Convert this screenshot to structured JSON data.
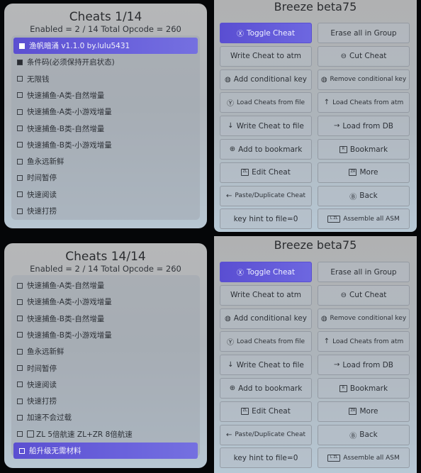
{
  "screens": [
    {
      "cheats": {
        "title": "Cheats 1/14",
        "subtitle": "Enabled = 2 / 14  Total Opcode = 260",
        "items": [
          {
            "label": "渔帆暗涌 v1.1.0 by.lulu5431",
            "checked": true,
            "selected": true
          },
          {
            "label": "条件码(必须保持开启状态)",
            "checked": true,
            "selected": false
          },
          {
            "label": "无限钱",
            "checked": false,
            "selected": false
          },
          {
            "label": "快速捕鱼-A类-自然增量",
            "checked": false,
            "selected": false
          },
          {
            "label": "快速捕鱼-A类-小游戏增量",
            "checked": false,
            "selected": false
          },
          {
            "label": "快速捕鱼-B类-自然增量",
            "checked": false,
            "selected": false
          },
          {
            "label": "快速捕鱼-B类-小游戏增量",
            "checked": false,
            "selected": false
          },
          {
            "label": "鱼永远新鲜",
            "checked": false,
            "selected": false
          },
          {
            "label": "时间暂停",
            "checked": false,
            "selected": false
          },
          {
            "label": "快速阅读",
            "checked": false,
            "selected": false
          },
          {
            "label": "快速打捞",
            "checked": false,
            "selected": false
          }
        ]
      },
      "menu": {
        "title": "Breeze beta75",
        "buttons": [
          {
            "icon": "Ⓧ",
            "icon_name": "x-button-icon",
            "label": "Toggle Cheat",
            "primary": true
          },
          {
            "icon": "",
            "icon_name": "",
            "label": "Erase all in Group"
          },
          {
            "icon": "",
            "icon_name": "",
            "label": "Write Cheat to atm"
          },
          {
            "icon": "⊖",
            "icon_name": "minus-button-icon",
            "label": "Cut Cheat"
          },
          {
            "icon": "◍",
            "icon_name": "left-stick-icon",
            "label": "Add conditional key"
          },
          {
            "icon": "◍",
            "icon_name": "right-stick-icon",
            "label": "Remove conditional key",
            "small": true
          },
          {
            "icon": "Ⓨ",
            "icon_name": "y-button-icon",
            "label": "Load Cheats from file",
            "small": true
          },
          {
            "icon": "↑",
            "icon_name": "dpad-up-icon",
            "label": "Load Cheats from atm",
            "small": true
          },
          {
            "icon": "↓",
            "icon_name": "dpad-down-icon",
            "label": "Write Cheat to file"
          },
          {
            "icon": "→",
            "icon_name": "dpad-right-icon",
            "label": "Load from DB"
          },
          {
            "icon": "⊕",
            "icon_name": "plus-button-icon",
            "label": "Add to bookmark"
          },
          {
            "icon": "R",
            "icon_name": "r-button-icon",
            "label": "Bookmark",
            "kbd": true
          },
          {
            "icon": "ZL",
            "icon_name": "zl-button-icon",
            "label": "Edit Cheat",
            "kbd": true
          },
          {
            "icon": "ZR",
            "icon_name": "zr-button-icon",
            "label": "More",
            "kbd": true
          },
          {
            "icon": "←",
            "icon_name": "dpad-left-icon",
            "label": "Paste/Duplicate Cheat",
            "small": true
          },
          {
            "icon": "Ⓑ",
            "icon_name": "b-button-icon",
            "label": "Back"
          },
          {
            "icon": "",
            "icon_name": "",
            "label": "key hint to file=0"
          },
          {
            "icon": "L ZL",
            "icon_name": "l-zl-button-icon",
            "label": "Assemble all ASM",
            "kbd": true,
            "small": true
          }
        ]
      }
    },
    {
      "cheats": {
        "title": "Cheats 14/14",
        "subtitle": "Enabled = 2 / 14  Total Opcode = 260",
        "items": [
          {
            "label": "快速捕鱼-A类-自然增量",
            "checked": false,
            "selected": false
          },
          {
            "label": "快速捕鱼-A类-小游戏增量",
            "checked": false,
            "selected": false
          },
          {
            "label": "快速捕鱼-B类-自然增量",
            "checked": false,
            "selected": false
          },
          {
            "label": "快速捕鱼-B类-小游戏增量",
            "checked": false,
            "selected": false
          },
          {
            "label": "鱼永远新鲜",
            "checked": false,
            "selected": false
          },
          {
            "label": "时间暂停",
            "checked": false,
            "selected": false
          },
          {
            "label": "快速阅读",
            "checked": false,
            "selected": false
          },
          {
            "label": "快速打捞",
            "checked": false,
            "selected": false
          },
          {
            "label": "加速不会过载",
            "checked": false,
            "selected": false
          },
          {
            "label": "ZL 5倍航速  ZL+ZR 8倍航速",
            "checked": false,
            "selected": false,
            "kbd": "ZL"
          },
          {
            "label": "船升级无需材料",
            "checked": false,
            "selected": true
          }
        ]
      },
      "menu": {
        "title": "Breeze beta75",
        "buttons": [
          {
            "icon": "Ⓧ",
            "icon_name": "x-button-icon",
            "label": "Toggle Cheat",
            "primary": true
          },
          {
            "icon": "",
            "icon_name": "",
            "label": "Erase all in Group"
          },
          {
            "icon": "",
            "icon_name": "",
            "label": "Write Cheat to atm"
          },
          {
            "icon": "⊖",
            "icon_name": "minus-button-icon",
            "label": "Cut Cheat"
          },
          {
            "icon": "◍",
            "icon_name": "left-stick-icon",
            "label": "Add conditional key"
          },
          {
            "icon": "◍",
            "icon_name": "right-stick-icon",
            "label": "Remove conditional key",
            "small": true
          },
          {
            "icon": "Ⓨ",
            "icon_name": "y-button-icon",
            "label": "Load Cheats from file",
            "small": true
          },
          {
            "icon": "↑",
            "icon_name": "dpad-up-icon",
            "label": "Load Cheats from atm",
            "small": true
          },
          {
            "icon": "↓",
            "icon_name": "dpad-down-icon",
            "label": "Write Cheat to file"
          },
          {
            "icon": "→",
            "icon_name": "dpad-right-icon",
            "label": "Load from DB"
          },
          {
            "icon": "⊕",
            "icon_name": "plus-button-icon",
            "label": "Add to bookmark"
          },
          {
            "icon": "R",
            "icon_name": "r-button-icon",
            "label": "Bookmark",
            "kbd": true
          },
          {
            "icon": "ZL",
            "icon_name": "zl-button-icon",
            "label": "Edit Cheat",
            "kbd": true
          },
          {
            "icon": "ZR",
            "icon_name": "zr-button-icon",
            "label": "More",
            "kbd": true
          },
          {
            "icon": "←",
            "icon_name": "dpad-left-icon",
            "label": "Paste/Duplicate Cheat",
            "small": true
          },
          {
            "icon": "Ⓑ",
            "icon_name": "b-button-icon",
            "label": "Back"
          },
          {
            "icon": "",
            "icon_name": "",
            "label": "key hint to file=0"
          },
          {
            "icon": "L ZL",
            "icon_name": "l-zl-button-icon",
            "label": "Assemble all ASM",
            "kbd": true,
            "small": true
          }
        ]
      }
    }
  ],
  "colors": {
    "accent": "#5b4fd1",
    "accent_light": "#7570e0",
    "background": "#050608"
  }
}
